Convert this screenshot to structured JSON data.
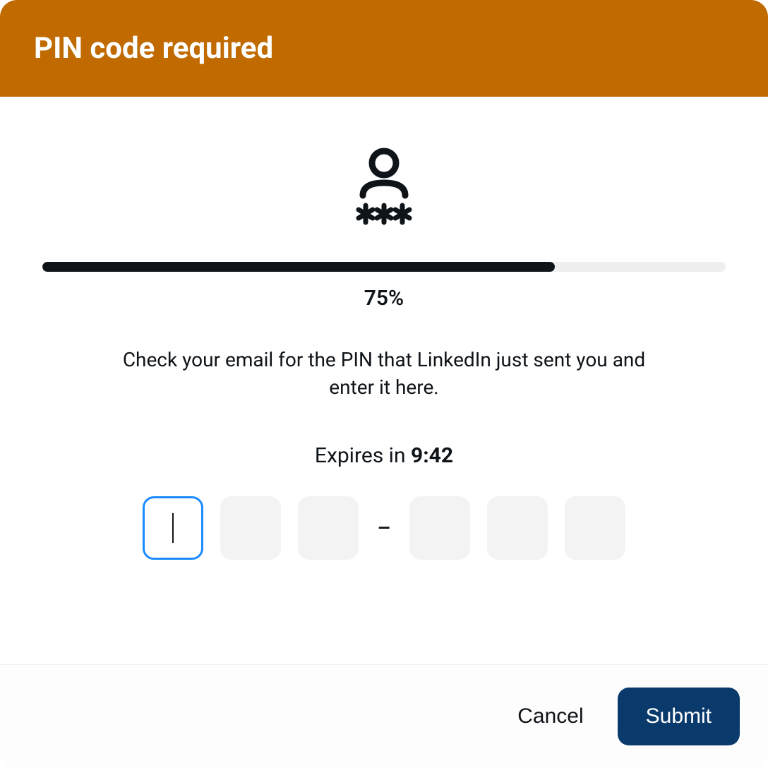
{
  "header": {
    "title": "PIN code required"
  },
  "icon": {
    "name": "user-pin-icon"
  },
  "progress": {
    "percent": 75,
    "label": "75%"
  },
  "instruction": "Check your email for the PIN that LinkedIn just sent you and enter it here.",
  "expires": {
    "prefix": "Expires in ",
    "time": "9:42"
  },
  "pin": {
    "boxes": [
      "",
      "",
      "",
      "",
      "",
      ""
    ],
    "separator": "–",
    "active_index": 0
  },
  "footer": {
    "cancel_label": "Cancel",
    "submit_label": "Submit"
  },
  "colors": {
    "header_bg": "#c06a00",
    "submit_bg": "#0a3a6b",
    "focus_border": "#1a8cff"
  }
}
